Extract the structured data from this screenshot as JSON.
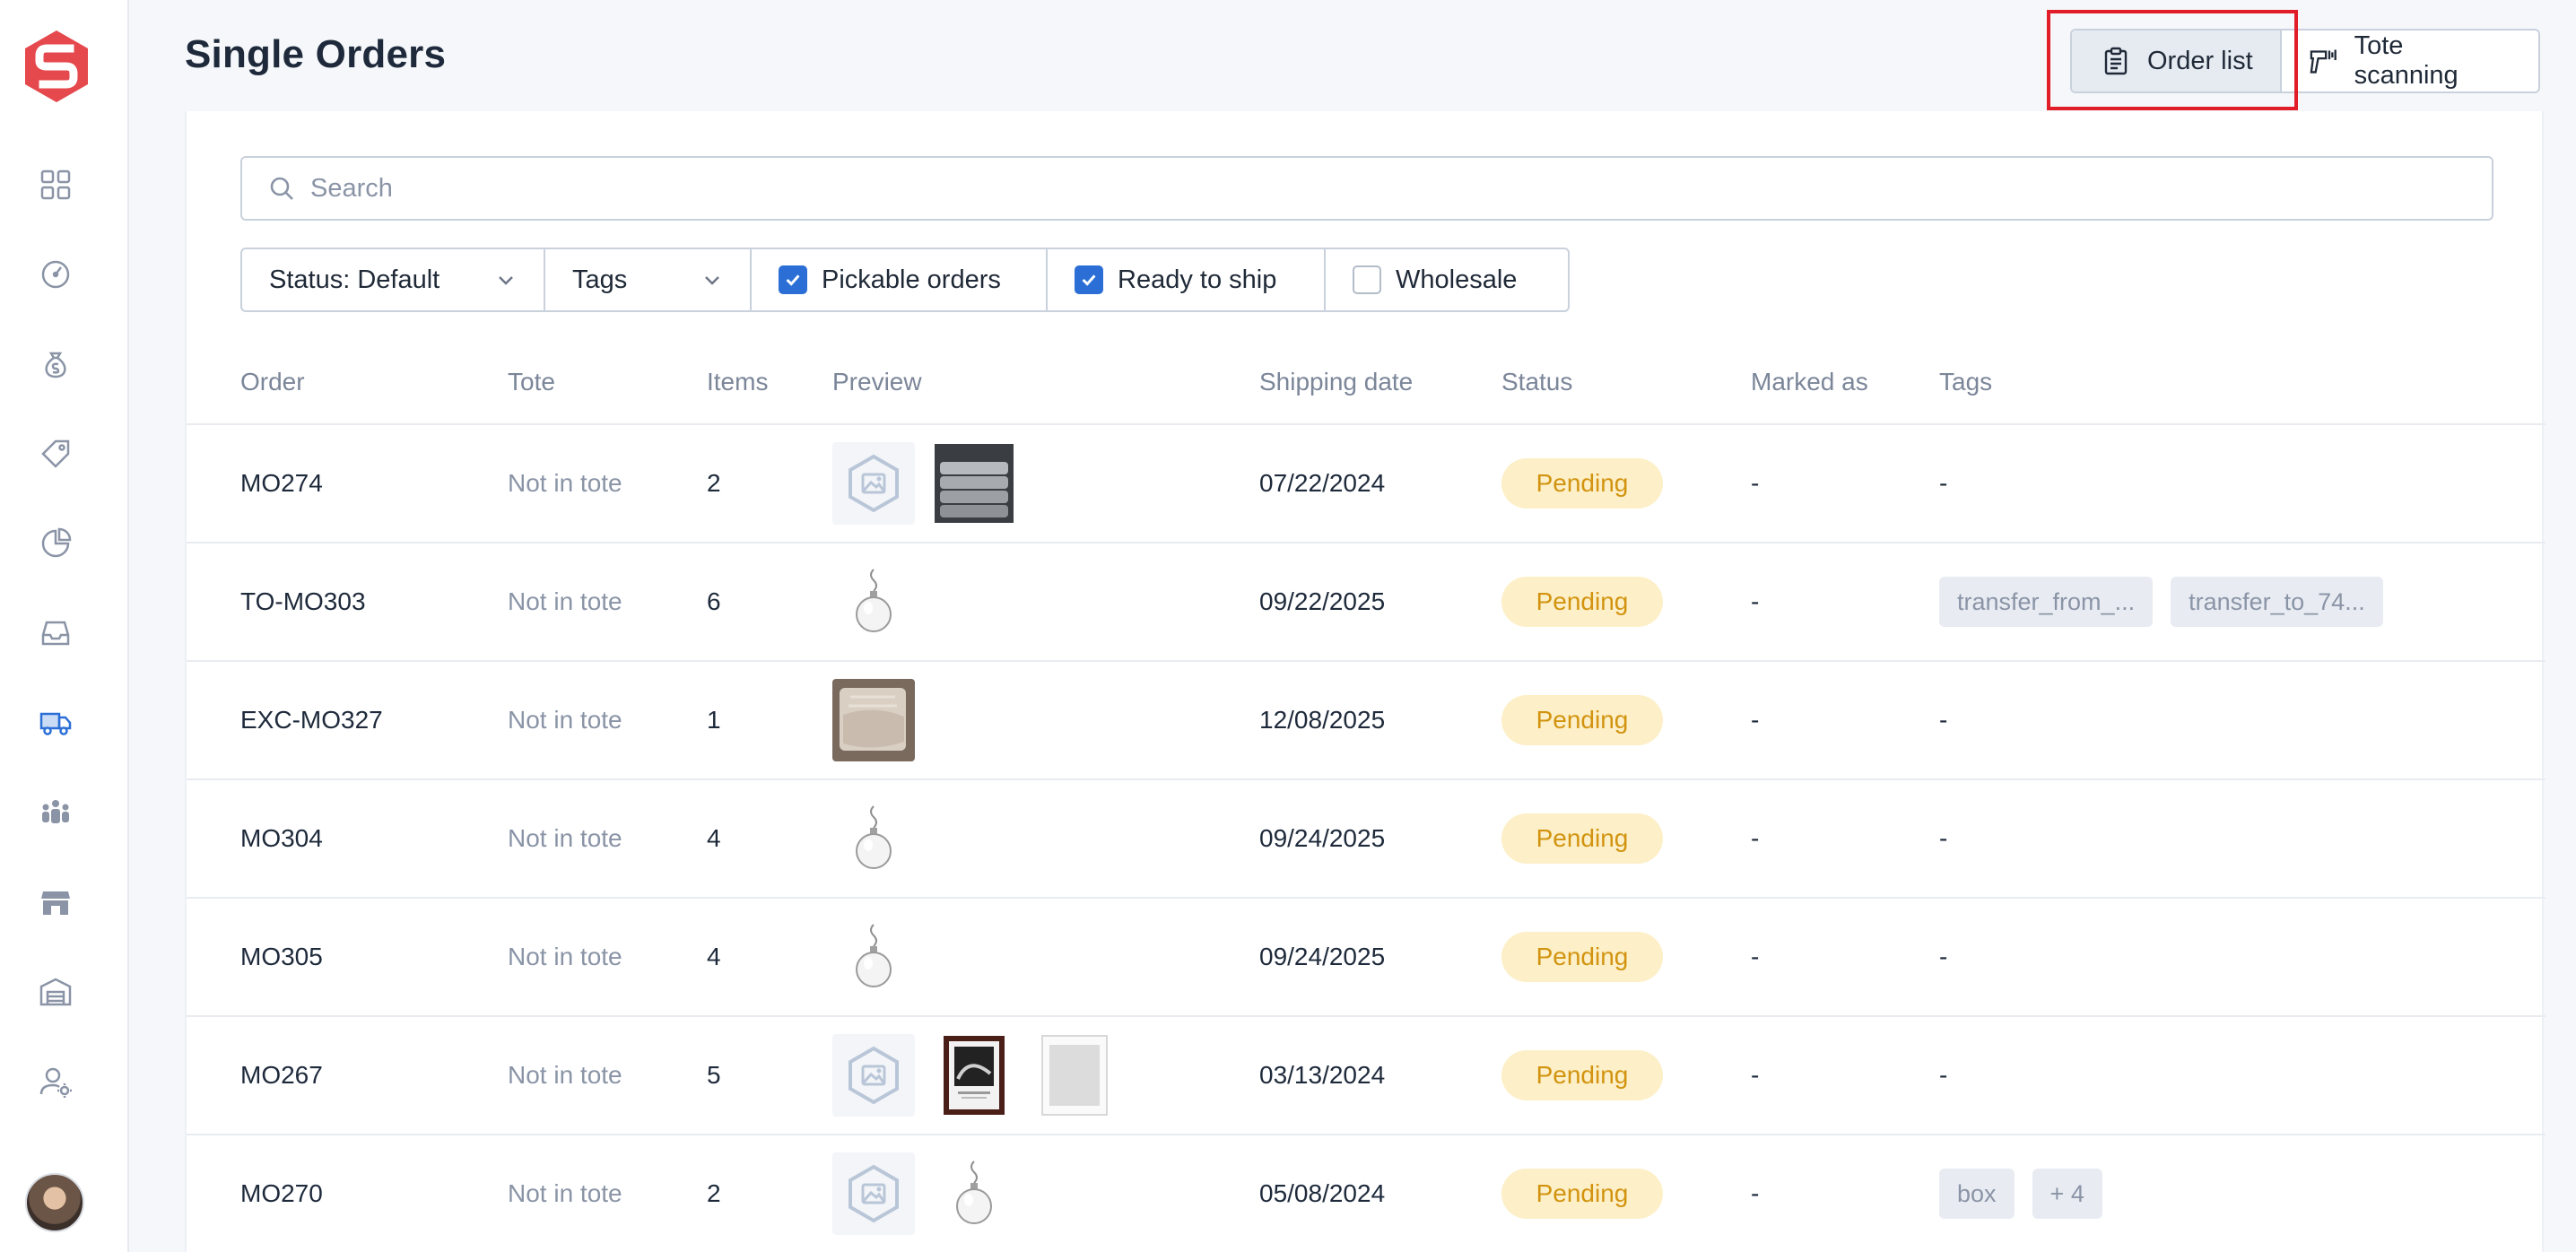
{
  "page": {
    "title": "Single Orders"
  },
  "view_toggle": {
    "order_list": "Order list",
    "tote_scanning": "Tote scanning"
  },
  "sidebar": {
    "items": [
      {
        "icon": "dashboard-grid-icon"
      },
      {
        "icon": "gauge-icon"
      },
      {
        "icon": "money-bag-icon"
      },
      {
        "icon": "price-tag-icon"
      },
      {
        "icon": "pie-chart-icon"
      },
      {
        "icon": "inbox-icon"
      },
      {
        "icon": "truck-icon",
        "active": true
      },
      {
        "icon": "team-icon"
      },
      {
        "icon": "store-icon"
      },
      {
        "icon": "warehouse-icon"
      },
      {
        "icon": "user-settings-icon"
      }
    ]
  },
  "search": {
    "placeholder": "Search"
  },
  "filters": {
    "status": "Status: Default",
    "tags": "Tags",
    "pickable": {
      "label": "Pickable orders",
      "checked": true
    },
    "ready": {
      "label": "Ready to ship",
      "checked": true
    },
    "wholesale": {
      "label": "Wholesale",
      "checked": false
    }
  },
  "table": {
    "headers": [
      "Order",
      "Tote",
      "Items",
      "Preview",
      "Shipping date",
      "Status",
      "Marked as",
      "Tags"
    ],
    "rows": [
      {
        "order": "MO274",
        "tote": "Not in tote",
        "items": "2",
        "preview": [
          "placeholder-image-icon",
          "towels-thumbnail"
        ],
        "date": "07/22/2024",
        "status": "Pending",
        "marked": "-",
        "tags": [
          "-"
        ]
      },
      {
        "order": "TO-MO303",
        "tote": "Not in tote",
        "items": "6",
        "preview": [
          "ornament-thumbnail"
        ],
        "date": "09/22/2025",
        "status": "Pending",
        "marked": "-",
        "tags": [
          "transfer_from_...",
          "transfer_to_74..."
        ]
      },
      {
        "order": "EXC-MO327",
        "tote": "Not in tote",
        "items": "1",
        "preview": [
          "blanket-thumbnail"
        ],
        "date": "12/08/2025",
        "status": "Pending",
        "marked": "-",
        "tags": [
          "-"
        ]
      },
      {
        "order": "MO304",
        "tote": "Not in tote",
        "items": "4",
        "preview": [
          "ornament-thumbnail"
        ],
        "date": "09/24/2025",
        "status": "Pending",
        "marked": "-",
        "tags": [
          "-"
        ]
      },
      {
        "order": "MO305",
        "tote": "Not in tote",
        "items": "4",
        "preview": [
          "ornament-thumbnail"
        ],
        "date": "09/24/2025",
        "status": "Pending",
        "marked": "-",
        "tags": [
          "-"
        ]
      },
      {
        "order": "MO267",
        "tote": "Not in tote",
        "items": "5",
        "preview": [
          "placeholder-image-icon",
          "framed-print-thumbnail",
          "frame-thumbnail"
        ],
        "date": "03/13/2024",
        "status": "Pending",
        "marked": "-",
        "tags": [
          "-"
        ]
      },
      {
        "order": "MO270",
        "tote": "Not in tote",
        "items": "2",
        "preview": [
          "placeholder-image-icon",
          "ornament-thumbnail"
        ],
        "date": "05/08/2024",
        "status": "Pending",
        "marked": "-",
        "tags": [
          "box",
          "+ 4"
        ]
      }
    ]
  },
  "colors": {
    "accent": "#2b6fd6",
    "brand": "#e5484d",
    "pending_bg": "#fdefc7",
    "pending_text": "#d29410",
    "highlight": "#e11d2a"
  }
}
